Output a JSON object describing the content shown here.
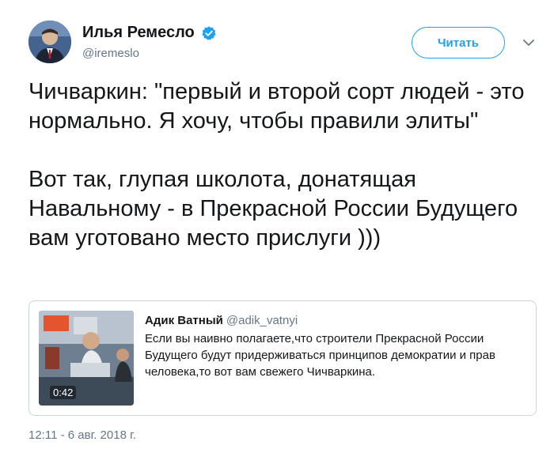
{
  "tweet": {
    "author": {
      "name": "Илья Ремесло",
      "handle": "@iremeslo",
      "verified": true
    },
    "follow_label": "Читать",
    "text_paragraphs": [
      "Чичваркин: \"первый и второй сорт людей - это нормально. Я хочу, чтобы правили элиты\"",
      "Вот так, глупая школота, донатящая Навальному - в Прекрасной России Будущего вам уготовано место прислуги )))"
    ],
    "quoted": {
      "name": "Адик Ватный",
      "handle": "@adik_vatnyi",
      "text": "Если вы наивно полагаете,что строители Прекрасной России Будущего будут придерживаться принципов демократии и прав человека,то вот вам свежего Чичваркина.",
      "video_duration": "0:42"
    },
    "timestamp": "12:11 - 6 авг. 2018 г."
  },
  "colors": {
    "accent": "#1da1f2",
    "muted": "#657786",
    "text": "#14171a",
    "border": "#ccd6dd"
  }
}
